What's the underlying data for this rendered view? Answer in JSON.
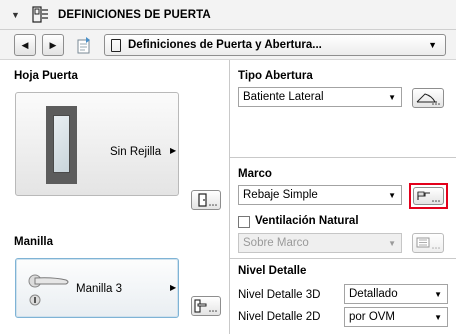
{
  "header": {
    "title": "DEFINICIONES DE PUERTA",
    "collapse_icon": "triangle-down-icon"
  },
  "nav": {
    "preset": "Definiciones de Puerta y Abertura..."
  },
  "leaf": {
    "title": "Hoja Puerta",
    "selection": "Sin Rejilla"
  },
  "handle": {
    "title": "Manilla",
    "selection": "Manilla 3"
  },
  "opening": {
    "title": "Tipo Abertura",
    "value": "Batiente Lateral"
  },
  "frame": {
    "title": "Marco",
    "value": "Rebaje Simple",
    "highlight_color": "#e3001b"
  },
  "ventilation": {
    "label": "Ventilación Natural",
    "checked": false,
    "value": "Sobre Marco"
  },
  "detail": {
    "title": "Nivel Detalle",
    "level3d_label": "Nivel Detalle 3D",
    "level3d_value": "Detallado",
    "level2d_label": "Nivel Detalle 2D",
    "level2d_value": "por OVM"
  }
}
